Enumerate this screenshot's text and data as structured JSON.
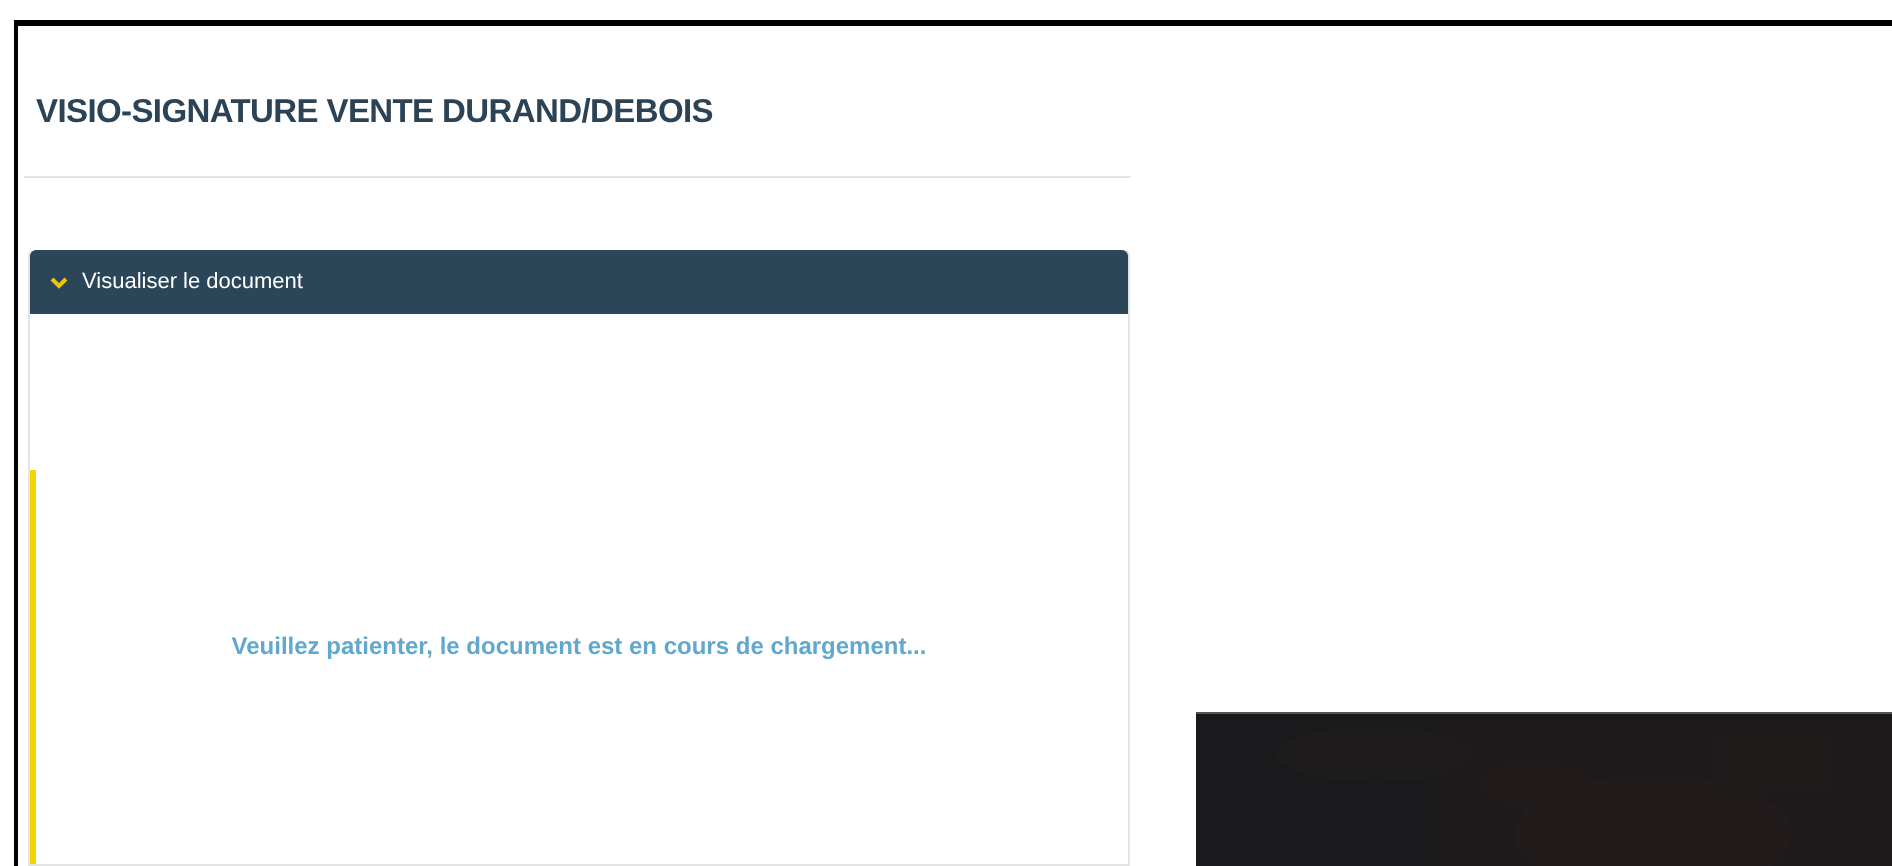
{
  "page": {
    "title": "VISIO-SIGNATURE VENTE DURAND/DEBOIS"
  },
  "document_panel": {
    "label": "Visualiser le document",
    "expanded": true,
    "loading_message": "Veuillez patienter, le document est en cours de chargement..."
  }
}
